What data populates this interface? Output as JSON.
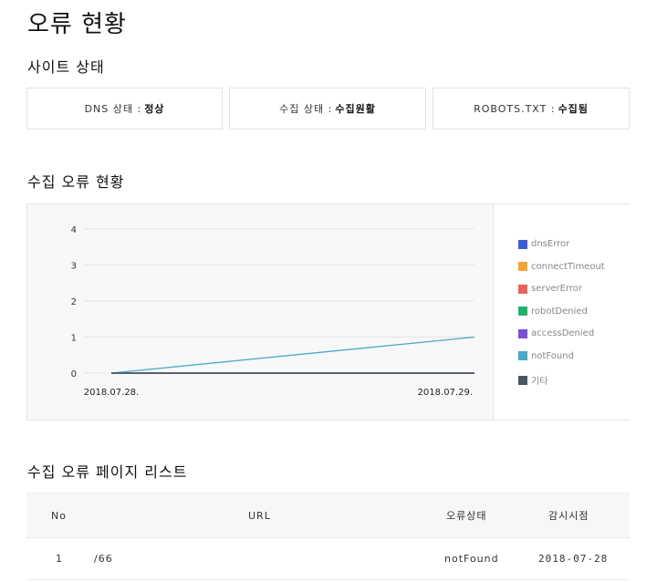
{
  "page": {
    "title": "오류 현황"
  },
  "site_status": {
    "heading": "사이트 상태",
    "cards": [
      {
        "label": "DNS 상태 :",
        "value": "정상"
      },
      {
        "label": "수집 상태 :",
        "value": "수집원활"
      },
      {
        "label": "ROBOTS.TXT :",
        "value": "수집됨"
      }
    ]
  },
  "crawl_errors": {
    "heading": "수집 오류 현황"
  },
  "chart_data": {
    "type": "line",
    "x": [
      "2018.07.28.",
      "2018.07.29."
    ],
    "ylim": [
      0,
      4
    ],
    "yticks": [
      "0",
      "1",
      "2",
      "3",
      "4"
    ],
    "grid": true,
    "legend_position": "right",
    "series": [
      {
        "name": "dnsError",
        "color": "#3a5bd6",
        "values": [
          0,
          0
        ]
      },
      {
        "name": "connectTimeout",
        "color": "#f2a33a",
        "values": [
          0,
          0
        ]
      },
      {
        "name": "serverError",
        "color": "#e8615e",
        "values": [
          0,
          0
        ]
      },
      {
        "name": "robotDenied",
        "color": "#20b26b",
        "values": [
          0,
          0
        ]
      },
      {
        "name": "accessDenied",
        "color": "#7a4fd9",
        "values": [
          0,
          0
        ]
      },
      {
        "name": "notFound",
        "color": "#4aa8c8",
        "values": [
          0,
          1
        ]
      },
      {
        "name": "기타",
        "color": "#4a5560",
        "values": [
          0,
          0
        ]
      }
    ]
  },
  "error_pages": {
    "heading": "수집 오류 페이지 리스트",
    "columns": [
      "No",
      "URL",
      "오류상태",
      "감시시점"
    ],
    "rows": [
      {
        "no": "1",
        "url": "/66",
        "status": "notFound",
        "time": "2018-07-28"
      }
    ]
  }
}
